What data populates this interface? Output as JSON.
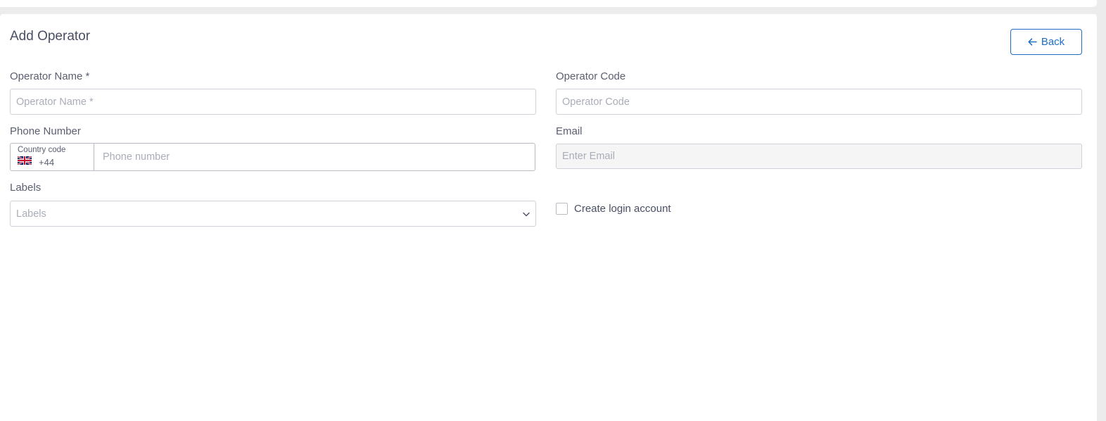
{
  "page": {
    "title": "Add Operator",
    "back_label": "Back"
  },
  "form": {
    "operator_name": {
      "label": "Operator Name *",
      "placeholder": "Operator Name *",
      "value": ""
    },
    "operator_code": {
      "label": "Operator Code",
      "placeholder": "Operator Code",
      "value": ""
    },
    "phone": {
      "label": "Phone Number",
      "country_code_label": "Country code",
      "country_flag": "uk-flag-icon",
      "country_code": "+44",
      "placeholder": "Phone number",
      "value": ""
    },
    "email": {
      "label": "Email",
      "placeholder": "Enter Email",
      "value": "",
      "disabled": true
    },
    "labels": {
      "label": "Labels",
      "placeholder": "Labels"
    },
    "create_login": {
      "label": "Create login account",
      "checked": false
    }
  },
  "colors": {
    "accent": "#1f6fc6",
    "text": "#4a4f63",
    "border": "#cfd2d8",
    "background": "#ececec"
  }
}
